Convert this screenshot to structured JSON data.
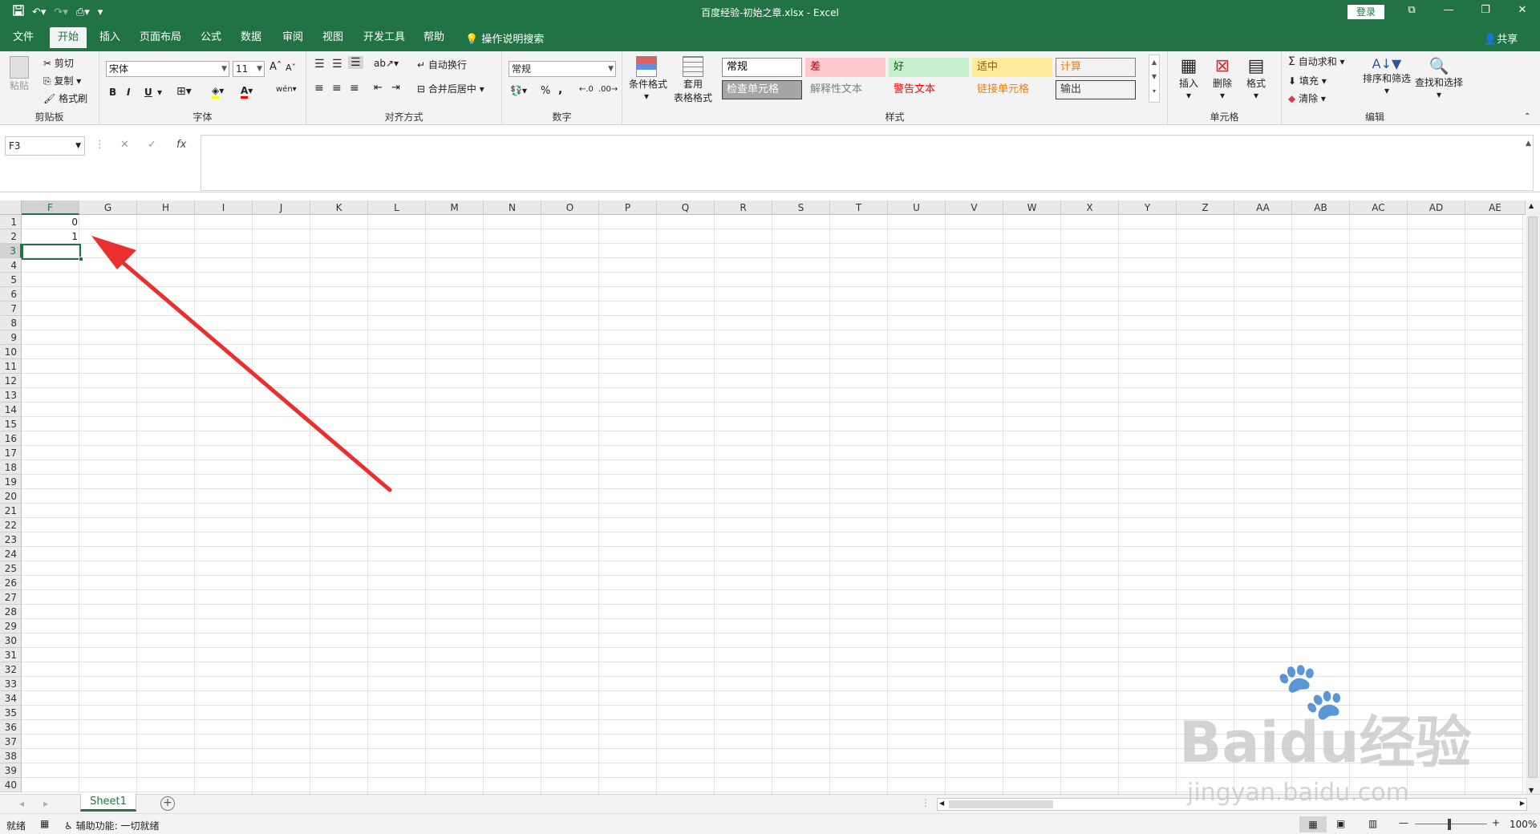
{
  "title": "百度经验-初始之章.xlsx  -  Excel",
  "login_label": "登录",
  "qat": {
    "save_icon": "save-icon",
    "undo_icon": "undo-icon",
    "redo_icon": "redo-icon",
    "print_icon": "print-preview-icon",
    "more": "▾"
  },
  "window": {
    "ribbon_display": "⧉",
    "minimize": "—",
    "restore": "❐",
    "close": "✕"
  },
  "tabs": [
    "文件",
    "开始",
    "插入",
    "页面布局",
    "公式",
    "数据",
    "审阅",
    "视图",
    "开发工具",
    "帮助"
  ],
  "active_tab": "开始",
  "tell_me": "操作说明搜索",
  "share": "共享",
  "ribbon": {
    "clipboard": {
      "label": "剪贴板",
      "paste": "粘贴",
      "cut": "剪切",
      "copy": "复制",
      "format_painter": "格式刷"
    },
    "font": {
      "label": "字体",
      "font_name": "宋体",
      "font_size": "11",
      "bold": "B",
      "italic": "I",
      "underline": "U",
      "grow": "A",
      "shrink": "A"
    },
    "alignment": {
      "label": "对齐方式",
      "wrap": "自动换行",
      "merge": "合并后居中"
    },
    "number": {
      "label": "数字",
      "format": "常规",
      "percent": "%",
      "comma": ","
    },
    "styles": {
      "label": "样式",
      "cond_format": "条件格式",
      "table_format_line1": "套用",
      "table_format_line2": "表格格式",
      "cells": [
        {
          "text": "常规",
          "bg": "#ffffff",
          "color": "#000000",
          "border": "#888888"
        },
        {
          "text": "差",
          "bg": "#ffc7ce",
          "color": "#9c0006",
          "border": "#ffc7ce"
        },
        {
          "text": "好",
          "bg": "#c6efce",
          "color": "#006100",
          "border": "#c6efce"
        },
        {
          "text": "适中",
          "bg": "#ffeb9c",
          "color": "#9c5700",
          "border": "#ffeb9c"
        },
        {
          "text": "计算",
          "bg": "#f2f2f2",
          "color": "#fa7d00",
          "border": "#7f7f7f"
        },
        {
          "text": "检查单元格",
          "bg": "#a5a5a5",
          "color": "#ffffff",
          "border": "#3f3f3f"
        },
        {
          "text": "解释性文本",
          "bg": "#f3f3f3",
          "color": "#7f7f7f",
          "border": "#f3f3f3"
        },
        {
          "text": "警告文本",
          "bg": "#f3f3f3",
          "color": "#ff0000",
          "border": "#f3f3f3"
        },
        {
          "text": "链接单元格",
          "bg": "#f3f3f3",
          "color": "#fa7d00",
          "border": "#f3f3f3"
        },
        {
          "text": "输出",
          "bg": "#f2f2f2",
          "color": "#3f3f3f",
          "border": "#3f3f3f"
        }
      ]
    },
    "cells_group": {
      "label": "单元格",
      "insert": "插入",
      "delete": "删除",
      "format": "格式"
    },
    "editing": {
      "label": "编辑",
      "autosum": "自动求和",
      "fill": "填充",
      "clear": "清除",
      "sort": "排序和筛选",
      "find": "查找和选择"
    }
  },
  "formula_bar": {
    "name_box": "F3",
    "cancel": "✕",
    "enter": "✓",
    "fx": "fx",
    "value": ""
  },
  "columns": [
    "F",
    "G",
    "H",
    "I",
    "J",
    "K",
    "L",
    "M",
    "N",
    "O",
    "P",
    "Q",
    "R",
    "S",
    "T",
    "U",
    "V",
    "W",
    "X",
    "Y",
    "Z",
    "AA",
    "AB",
    "AC",
    "AD",
    "AE"
  ],
  "rows": [
    "1",
    "2",
    "3",
    "4",
    "5",
    "6",
    "7",
    "8",
    "9",
    "10",
    "11",
    "12",
    "13",
    "14",
    "15",
    "16",
    "17",
    "18",
    "19",
    "20",
    "21",
    "22",
    "23",
    "24",
    "25",
    "26",
    "27",
    "28",
    "29",
    "30",
    "31",
    "32",
    "33",
    "34",
    "35",
    "36",
    "37",
    "38",
    "39",
    "40"
  ],
  "cells": [
    {
      "ref": "F1",
      "value": "0"
    },
    {
      "ref": "F2",
      "value": "1"
    }
  ],
  "selected_cell": "F3",
  "sheets": [
    "Sheet1"
  ],
  "active_sheet": "Sheet1",
  "status": {
    "ready": "就绪",
    "accessibility": "辅助功能: 一切就绪",
    "zoom": "100%"
  },
  "watermark": {
    "line1": "Baidu经验",
    "line2": "jingyan.baidu.com"
  },
  "accent_color": "#217346",
  "arrow_color": "#e8312e"
}
